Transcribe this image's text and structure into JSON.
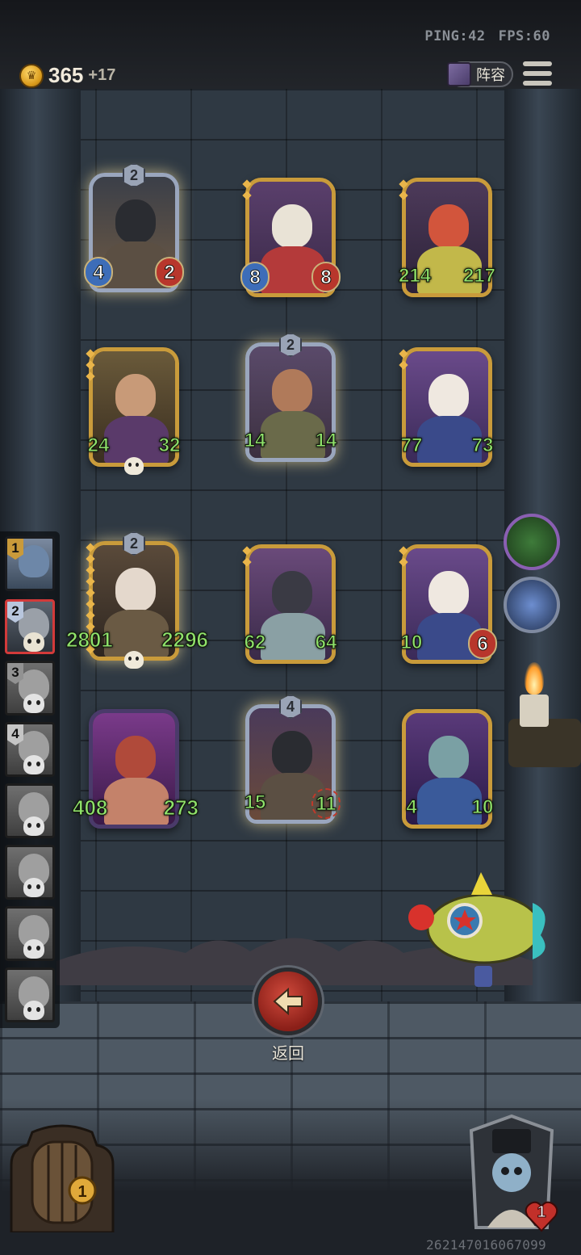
{
  "status": {
    "ping": "PING:42",
    "fps": "FPS:60"
  },
  "gold": {
    "amount": "365",
    "income": "+17"
  },
  "toolbar": {
    "lineup_label": "阵容"
  },
  "sidebar": {
    "players": [
      {
        "rank": "1",
        "state": "active"
      },
      {
        "rank": "2",
        "state": "me"
      },
      {
        "rank": "3",
        "state": "dead"
      },
      {
        "rank": "4",
        "state": "dead"
      },
      {
        "rank": "",
        "state": "dead"
      },
      {
        "rank": "",
        "state": "dead"
      },
      {
        "rank": "",
        "state": "dead"
      },
      {
        "rank": "",
        "state": "dead"
      }
    ]
  },
  "board": {
    "minions": [
      {
        "attack": "4",
        "health": "2",
        "tier": "2",
        "type": "armored-knight"
      },
      {
        "attack": "8",
        "health": "8",
        "type": "jester"
      },
      {
        "attack": "214",
        "health": "217",
        "type": "grinning-imp"
      },
      {
        "attack": "24",
        "health": "32",
        "type": "pirate-captain"
      },
      {
        "attack": "14",
        "health": "14",
        "tier": "2",
        "type": "bearded-brute"
      },
      {
        "attack": "77",
        "health": "73",
        "type": "clown"
      },
      {
        "attack": "2801",
        "health": "2296",
        "tier": "2",
        "type": "mad-scientist"
      },
      {
        "attack": "62",
        "health": "64",
        "type": "bat-demon"
      },
      {
        "attack": "10",
        "health": "6",
        "type": "clown"
      },
      {
        "attack": "408",
        "health": "273",
        "type": "dragon"
      },
      {
        "attack": "15",
        "health": "11",
        "tier": "4",
        "type": "armored-knight"
      },
      {
        "attack": "4",
        "health": "10",
        "type": "elf-sorceress"
      }
    ]
  },
  "actions": {
    "return_label": "返回"
  },
  "hero": {
    "health": "1",
    "shop_tier": "1"
  },
  "footer": {
    "game_id": "2621470160670​99"
  },
  "colors": {
    "gold_frame": "#c99b3b",
    "silver_frame": "#9aa6bd",
    "buffed_stat": "#8fe36a",
    "return_red": "#b83227"
  }
}
